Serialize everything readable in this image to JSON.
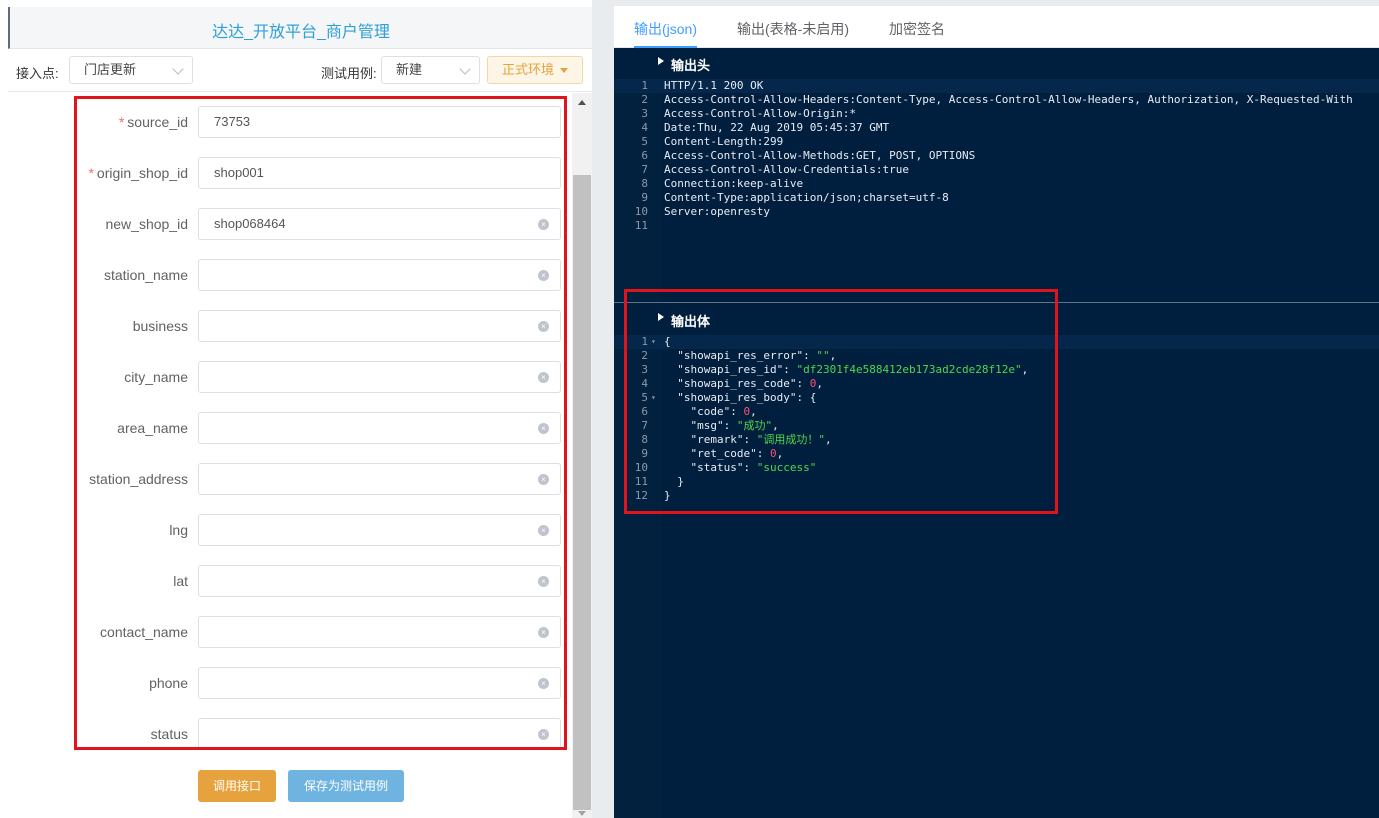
{
  "left": {
    "title": "达达_开放平台_商户管理",
    "access_point_label": "接入点:",
    "access_point_value": "门店更新",
    "test_case_label": "测试用例:",
    "test_case_value": "新建",
    "env_button": "正式环境",
    "fields": [
      {
        "label": "source_id",
        "required": true,
        "value": "73753",
        "clearable": false
      },
      {
        "label": "origin_shop_id",
        "required": true,
        "value": "shop001",
        "clearable": false
      },
      {
        "label": "new_shop_id",
        "required": false,
        "value": "shop068464",
        "clearable": true
      },
      {
        "label": "station_name",
        "required": false,
        "value": "",
        "clearable": true
      },
      {
        "label": "business",
        "required": false,
        "value": "",
        "clearable": true
      },
      {
        "label": "city_name",
        "required": false,
        "value": "",
        "clearable": true
      },
      {
        "label": "area_name",
        "required": false,
        "value": "",
        "clearable": true
      },
      {
        "label": "station_address",
        "required": false,
        "value": "",
        "clearable": true
      },
      {
        "label": "lng",
        "required": false,
        "value": "",
        "clearable": true
      },
      {
        "label": "lat",
        "required": false,
        "value": "",
        "clearable": true
      },
      {
        "label": "contact_name",
        "required": false,
        "value": "",
        "clearable": true
      },
      {
        "label": "phone",
        "required": false,
        "value": "",
        "clearable": true
      },
      {
        "label": "status",
        "required": false,
        "value": "",
        "clearable": true
      }
    ],
    "call_button": "调用接口",
    "save_button": "保存为测试用例"
  },
  "right": {
    "tabs": [
      "输出(json)",
      "输出(表格-未启用)",
      "加密签名"
    ],
    "active_tab": 0,
    "header_section_label": "输出头",
    "header_lines": [
      "HTTP/1.1 200 OK",
      "Access-Control-Allow-Headers:Content-Type, Access-Control-Allow-Headers, Authorization, X-Requested-With",
      "Access-Control-Allow-Origin:*",
      "Date:Thu, 22 Aug 2019 05:45:37 GMT",
      "Content-Length:299",
      "Access-Control-Allow-Methods:GET, POST, OPTIONS",
      "Access-Control-Allow-Credentials:true",
      "Connection:keep-alive",
      "Content-Type:application/json;charset=utf-8",
      "Server:openresty",
      ""
    ],
    "body_section_label": "输出体",
    "body_lines": [
      [
        {
          "t": "k",
          "v": "{"
        }
      ],
      [
        {
          "t": "k",
          "v": "  \"showapi_res_error\": "
        },
        {
          "t": "s",
          "v": "\"\""
        },
        {
          "t": "k",
          "v": ","
        }
      ],
      [
        {
          "t": "k",
          "v": "  \"showapi_res_id\": "
        },
        {
          "t": "s",
          "v": "\"df2301f4e588412eb173ad2cde28f12e\""
        },
        {
          "t": "k",
          "v": ","
        }
      ],
      [
        {
          "t": "k",
          "v": "  \"showapi_res_code\": "
        },
        {
          "t": "n",
          "v": "0"
        },
        {
          "t": "k",
          "v": ","
        }
      ],
      [
        {
          "t": "k",
          "v": "  \"showapi_res_body\": {"
        }
      ],
      [
        {
          "t": "k",
          "v": "    \"code\": "
        },
        {
          "t": "n",
          "v": "0"
        },
        {
          "t": "k",
          "v": ","
        }
      ],
      [
        {
          "t": "k",
          "v": "    \"msg\": "
        },
        {
          "t": "s",
          "v": "\"成功\""
        },
        {
          "t": "k",
          "v": ","
        }
      ],
      [
        {
          "t": "k",
          "v": "    \"remark\": "
        },
        {
          "t": "s",
          "v": "\"调用成功！\""
        },
        {
          "t": "k",
          "v": ","
        }
      ],
      [
        {
          "t": "k",
          "v": "    \"ret_code\": "
        },
        {
          "t": "n",
          "v": "0"
        },
        {
          "t": "k",
          "v": ","
        }
      ],
      [
        {
          "t": "k",
          "v": "    \"status\": "
        },
        {
          "t": "s",
          "v": "\"success\""
        }
      ],
      [
        {
          "t": "k",
          "v": "  }"
        }
      ],
      [
        {
          "t": "k",
          "v": "}"
        }
      ]
    ],
    "body_fold_lines": [
      1,
      5
    ]
  }
}
